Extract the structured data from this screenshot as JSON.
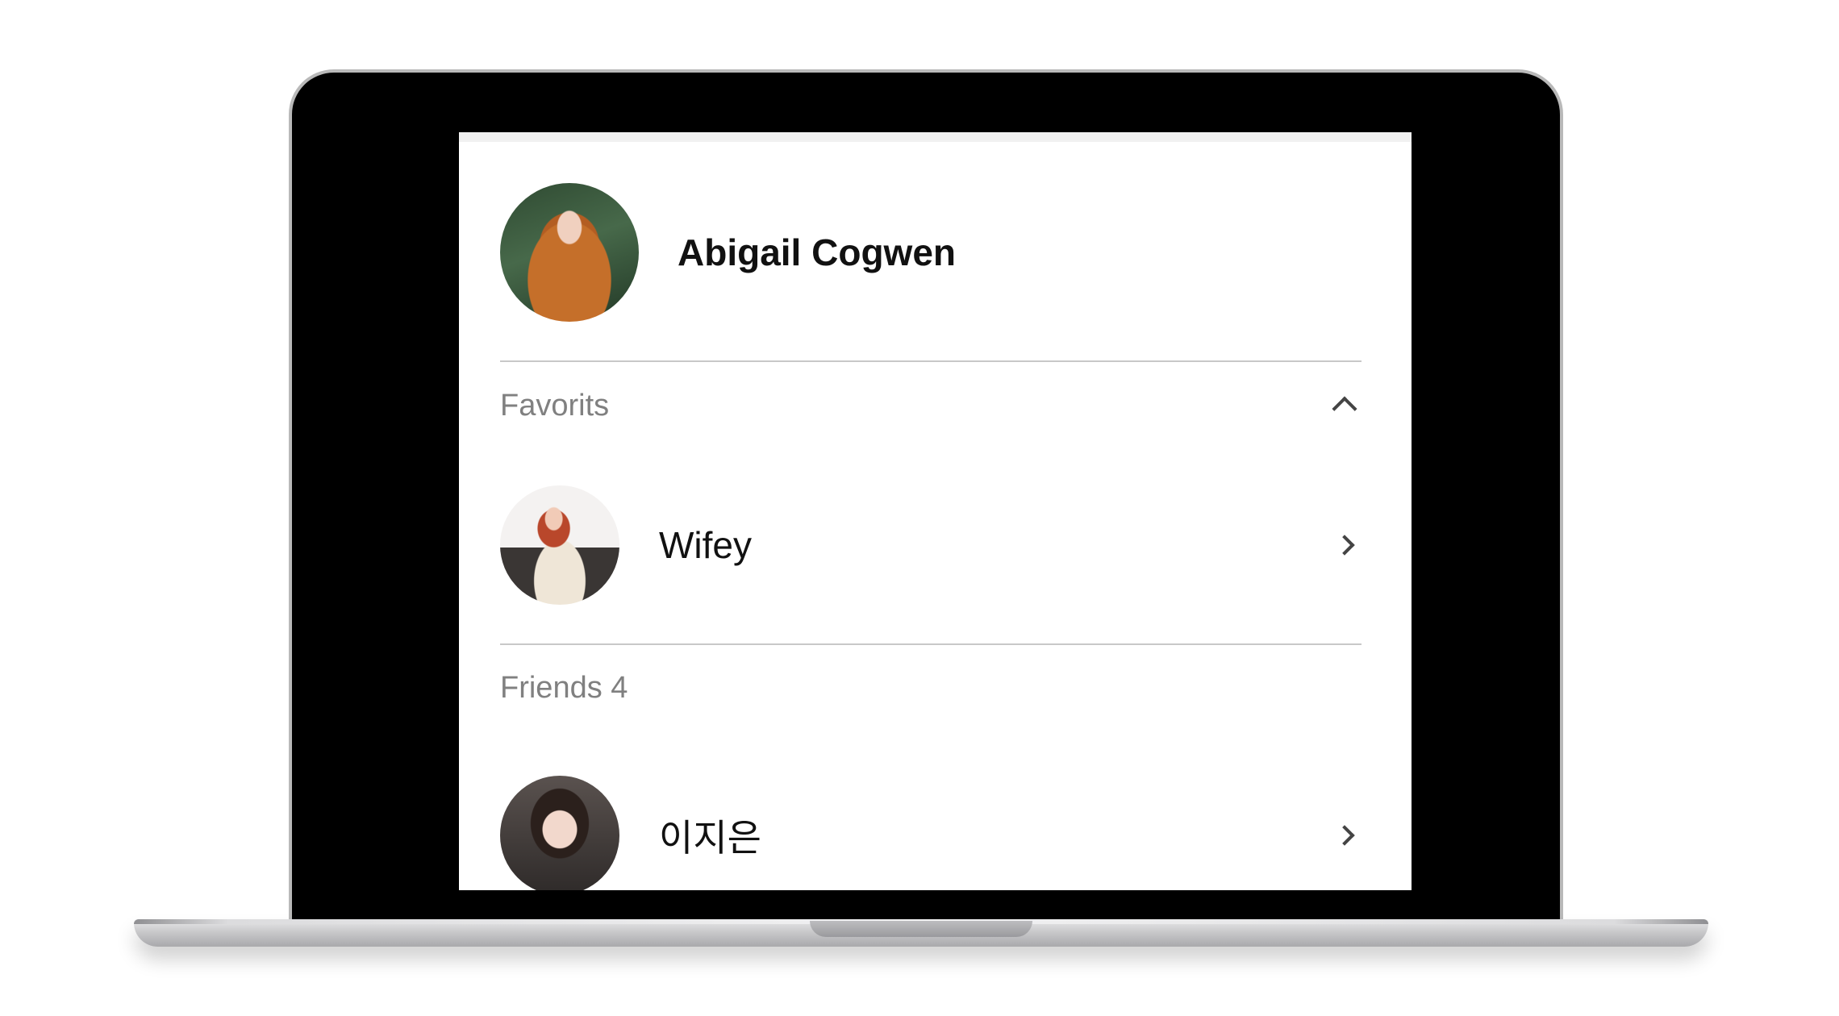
{
  "profile": {
    "name": "Abigail Cogwen",
    "avatar_icon": "profile-photo"
  },
  "sections": {
    "favorites": {
      "title": "Favorits",
      "toggle_icon": "chevron-up-icon",
      "items": [
        {
          "name": "Wifey",
          "avatar_icon": "contact-photo",
          "arrow_icon": "chevron-right-icon"
        }
      ]
    },
    "friends": {
      "title": "Friends 4",
      "items": [
        {
          "name": "이지은",
          "avatar_icon": "contact-photo",
          "arrow_icon": "chevron-right-icon"
        }
      ]
    }
  }
}
